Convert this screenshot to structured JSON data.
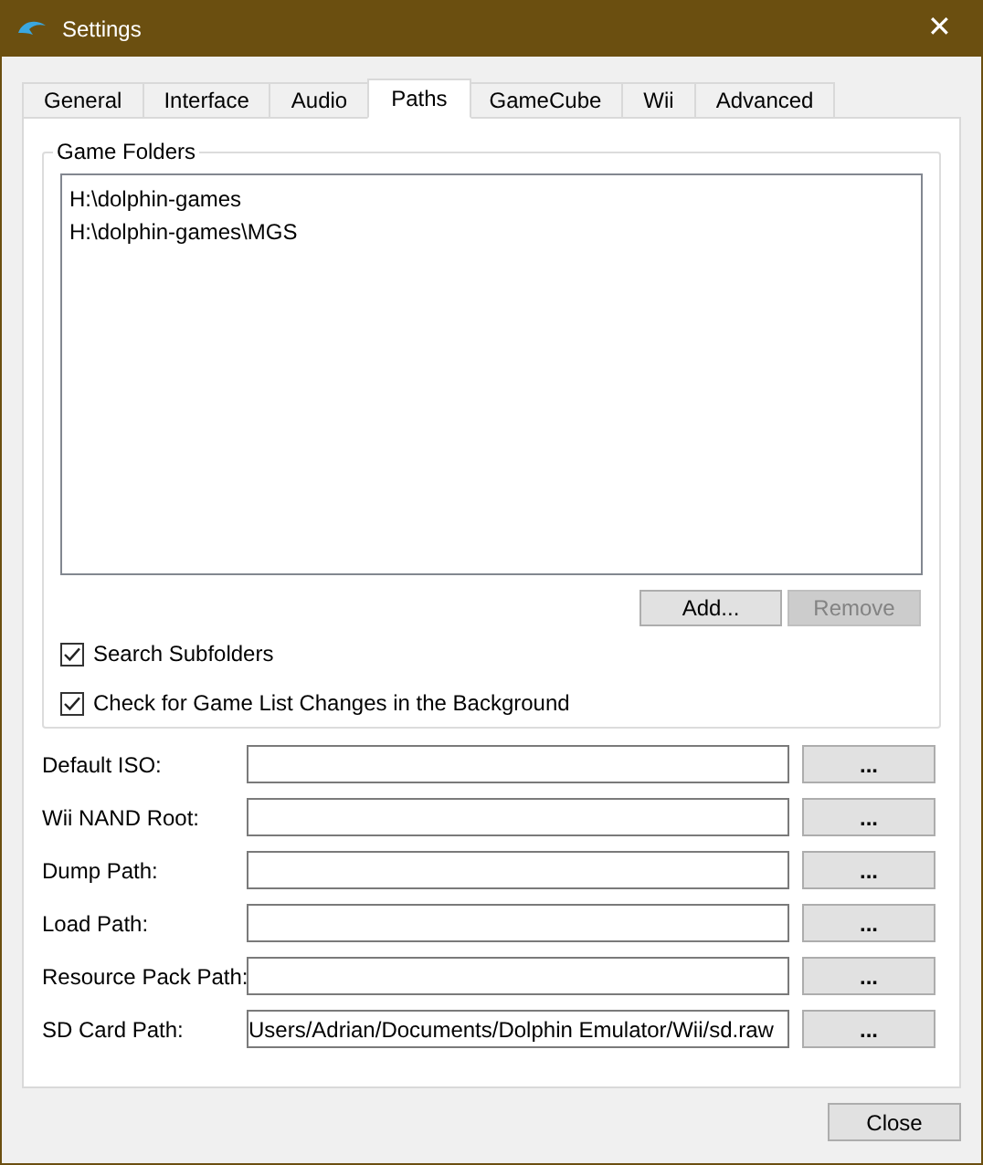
{
  "window": {
    "title": "Settings",
    "close": "✕"
  },
  "tabs": [
    {
      "label": "General",
      "selected": false
    },
    {
      "label": "Interface",
      "selected": false
    },
    {
      "label": "Audio",
      "selected": false
    },
    {
      "label": "Paths",
      "selected": true
    },
    {
      "label": "GameCube",
      "selected": false
    },
    {
      "label": "Wii",
      "selected": false
    },
    {
      "label": "Advanced",
      "selected": false
    }
  ],
  "game_folders": {
    "title": "Game Folders",
    "items": [
      "H:\\dolphin-games",
      "H:\\dolphin-games\\MGS"
    ],
    "buttons": [
      {
        "label": "Add...",
        "disabled": false
      },
      {
        "label": "Remove",
        "disabled": true
      }
    ],
    "checkboxes": [
      {
        "label": "Search Subfolders",
        "checked": true
      },
      {
        "label": "Check for Game List Changes in the Background",
        "checked": true
      }
    ]
  },
  "paths": [
    {
      "label": "Default ISO:",
      "button": "..."
    },
    {
      "label": "Wii NAND Root:",
      "button": "..."
    },
    {
      "label": "Dump Path:",
      "button": "..."
    },
    {
      "label": "Load Path:",
      "button": "..."
    },
    {
      "label": "Resource Pack Path:",
      "button": "..."
    },
    {
      "label": "SD Card Path:",
      "value": "Users/Adrian/Documents/Dolphin Emulator/Wii/sd.raw",
      "button": "..."
    }
  ],
  "footer_button": "Close"
}
